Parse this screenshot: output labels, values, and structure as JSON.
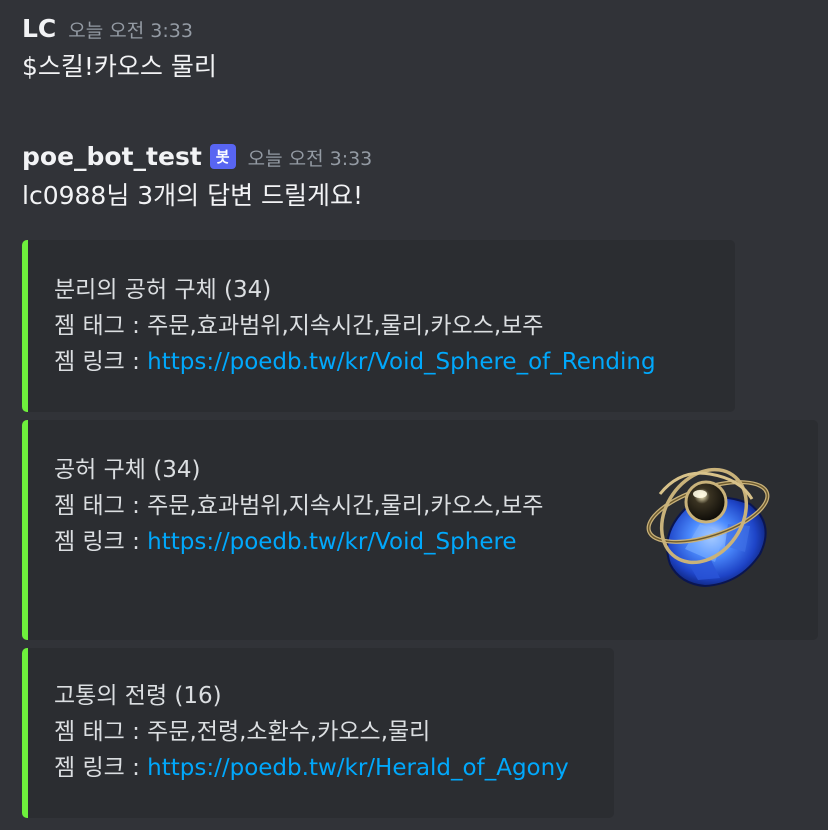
{
  "messages": [
    {
      "author": "LC",
      "timestamp": "오늘 오전 3:33",
      "text": "$스킬!카오스 물리"
    },
    {
      "author": "poe_bot_test",
      "badge": "봇",
      "timestamp": "오늘 오전 3:33",
      "text": "lc0988님 3개의 답변 드릴게요!"
    }
  ],
  "embeds": [
    {
      "title": "분리의 공허 구체 (34)",
      "tags_label": "젬 태그 : ",
      "tags": "주문,효과범위,지속시간,물리,카오스,보주",
      "link_label": "젬 링크 : ",
      "link": "https://poedb.tw/kr/Void_Sphere_of_Rending"
    },
    {
      "title": "공허 구체 (34)",
      "tags_label": "젬 태그 : ",
      "tags": "주문,효과범위,지속시간,물리,카오스,보주",
      "link_label": "젬 링크 : ",
      "link": "https://poedb.tw/kr/Void_Sphere",
      "thumbnail": "void-sphere-gem-icon"
    },
    {
      "title": "고통의 전령 (16)",
      "tags_label": "젬 태그 : ",
      "tags": "주문,전령,소환수,카오스,물리",
      "link_label": "젬 링크 : ",
      "link": "https://poedb.tw/kr/Herald_of_Agony"
    }
  ],
  "colors": {
    "background": "#313338",
    "embed_background": "#2b2d31",
    "embed_accent": "#6ef03c",
    "link": "#00a8fc",
    "bot_badge": "#5865f2"
  }
}
